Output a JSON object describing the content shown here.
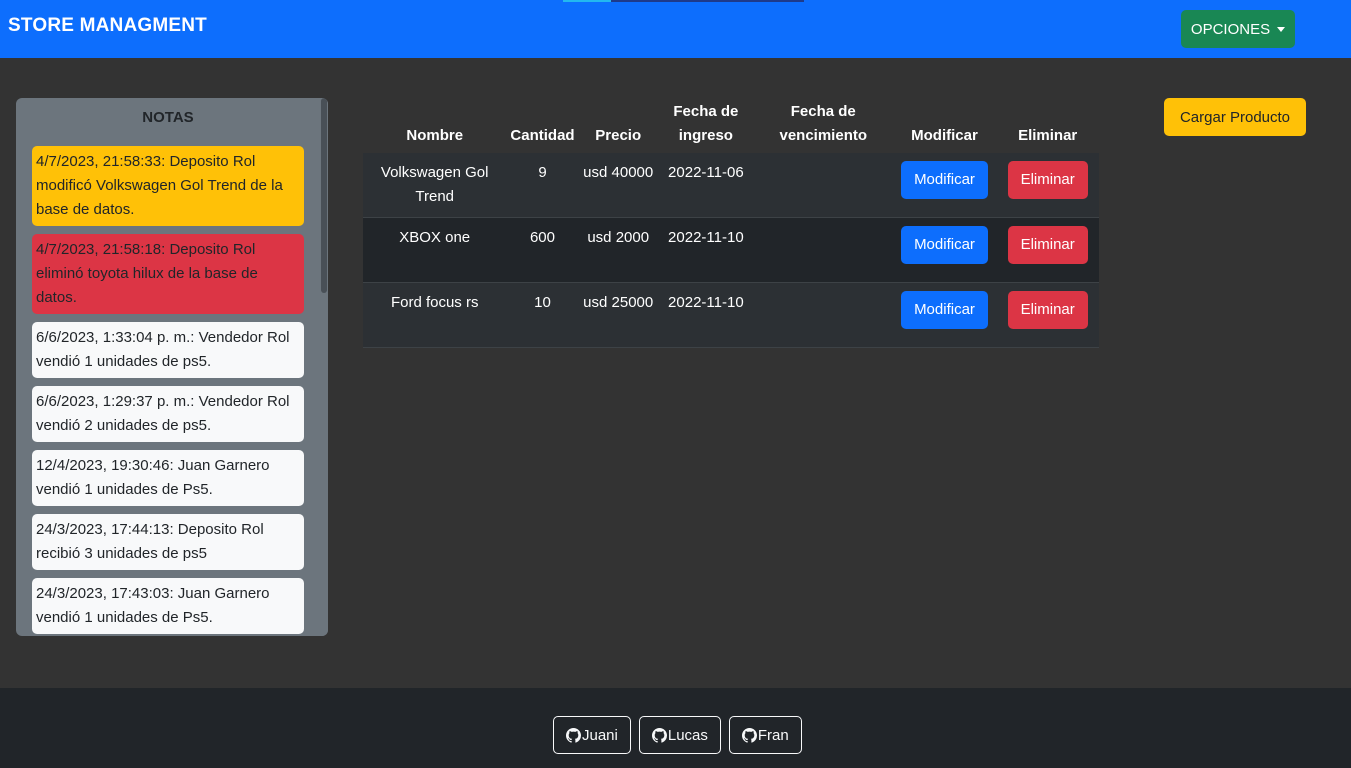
{
  "navbar": {
    "brand": "STORE MANAGMENT",
    "options_label": "OPCIONES",
    "color": "#0d6efd"
  },
  "notes": {
    "title": "NOTAS",
    "items": [
      {
        "text": "4/7/2023, 21:58:33: Deposito Rol modificó Volkswagen Gol Trend de la base de datos.",
        "variant": "warning"
      },
      {
        "text": "4/7/2023, 21:58:18: Deposito Rol eliminó toyota hilux de la base de datos.",
        "variant": "danger"
      },
      {
        "text": "6/6/2023, 1:33:04 p. m.: Vendedor Rol vendió 1 unidades de ps5.",
        "variant": "light"
      },
      {
        "text": "6/6/2023, 1:29:37 p. m.: Vendedor Rol vendió 2 unidades de ps5.",
        "variant": "light"
      },
      {
        "text": "12/4/2023, 19:30:46: Juan Garnero vendió 1 unidades de Ps5.",
        "variant": "light"
      },
      {
        "text": "24/3/2023, 17:44:13: Deposito Rol recibió 3 unidades de ps5",
        "variant": "light"
      },
      {
        "text": "24/3/2023, 17:43:03: Juan Garnero vendió 1 unidades de Ps5.",
        "variant": "light"
      }
    ]
  },
  "table": {
    "headers": {
      "nombre": "Nombre",
      "cantidad": "Cantidad",
      "precio": "Precio",
      "fecha_ingreso": "Fecha de ingreso",
      "fecha_vencimiento": "Fecha de vencimiento",
      "modificar": "Modificar",
      "eliminar": "Eliminar"
    },
    "rows": [
      {
        "nombre": "Volkswagen Gol Trend",
        "cantidad": "9",
        "precio": "usd 40000",
        "fecha_ingreso": "2022-11-06",
        "fecha_vencimiento": "",
        "modificar": "Modificar",
        "eliminar": "Eliminar"
      },
      {
        "nombre": "XBOX one",
        "cantidad": "600",
        "precio": "usd 2000",
        "fecha_ingreso": "2022-11-10",
        "fecha_vencimiento": "",
        "modificar": "Modificar",
        "eliminar": "Eliminar"
      },
      {
        "nombre": "Ford focus rs",
        "cantidad": "10",
        "precio": "usd 25000",
        "fecha_ingreso": "2022-11-10",
        "fecha_vencimiento": "",
        "modificar": "Modificar",
        "eliminar": "Eliminar"
      }
    ]
  },
  "load_product_label": "Cargar Producto",
  "footer": {
    "links": [
      {
        "label": "Juani",
        "icon": "github-icon"
      },
      {
        "label": "Lucas",
        "icon": "github-icon"
      },
      {
        "label": "Fran",
        "icon": "github-icon"
      }
    ]
  }
}
